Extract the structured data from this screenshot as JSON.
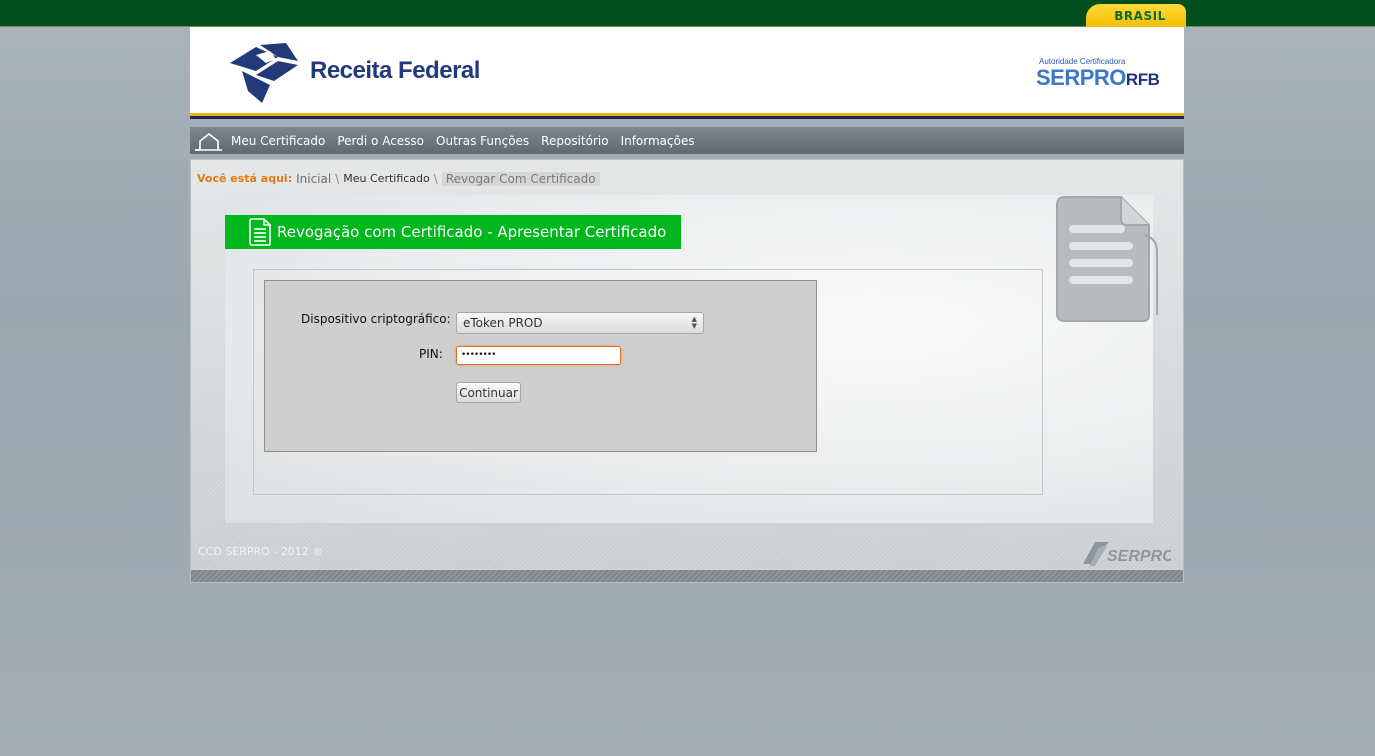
{
  "gov_bar": {
    "brasil_label": "BRASIL"
  },
  "header": {
    "logo_text": "Receita Federal",
    "ac_small": "Autoridade Certificadora",
    "ac_serpro": "SERPRO",
    "ac_rfb": "RFB"
  },
  "nav": {
    "items": [
      {
        "label": "Meu Certificado"
      },
      {
        "label": "Perdi o Acesso"
      },
      {
        "label": "Outras Funções"
      },
      {
        "label": "Repositório"
      },
      {
        "label": "Informações"
      }
    ]
  },
  "breadcrumb": {
    "prefix": "Você está aqui:",
    "items": [
      "Inicial",
      "Meu Certificado",
      "Revogar Com Certificado"
    ],
    "separator": "\\"
  },
  "page": {
    "title": "Revogação com Certificado - Apresentar Certificado"
  },
  "form": {
    "device_label": "Dispositivo criptográfico:",
    "device_value": "eToken PROD",
    "pin_label": "PIN:",
    "pin_value": "••••••••",
    "submit_label": "Continuar"
  },
  "footer": {
    "copyright": "CCD SERPRO - 2012 ®",
    "logo_text": "SERPRO"
  },
  "colors": {
    "gov_green": "#004f1c",
    "title_green": "#00b71e",
    "breadcrumb_orange": "#e27a14",
    "nav_gray": "#6e787e"
  }
}
